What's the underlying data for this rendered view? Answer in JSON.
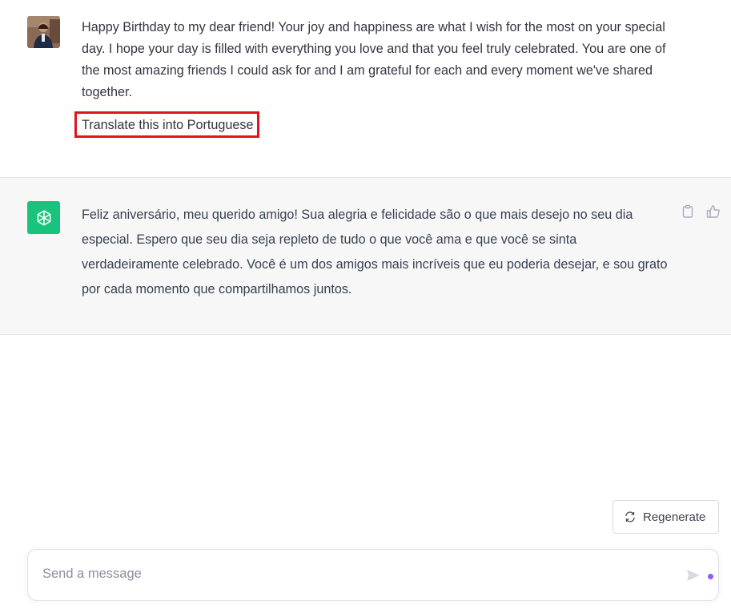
{
  "user_message": {
    "paragraph": "Happy Birthday to my dear friend! Your joy and happiness are what I wish for the most on your special day. I hope your day is filled with everything you love and that you feel truly celebrated. You are one of the most amazing friends I could ask for and I am grateful for each and every moment we've shared together.",
    "instruction": "Translate this into Portuguese"
  },
  "assistant_message": {
    "text": "Feliz aniversário, meu querido amigo! Sua alegria e felicidade são o que mais desejo no seu dia especial. Espero que seu dia seja repleto de tudo o que você ama e que você se sinta verdadeiramente celebrado. Você é um dos amigos mais incríveis que eu poderia desejar, e sou grato por cada momento que compartilhamos juntos."
  },
  "actions": {
    "copy_icon": "clipboard-icon",
    "like_icon": "thumbs-up-icon"
  },
  "regenerate": {
    "label": "Regenerate",
    "icon": "refresh-icon"
  },
  "composer": {
    "placeholder": "Send a message",
    "send_icon": "send-icon"
  },
  "colors": {
    "bot_accent": "#19c37d",
    "highlight_border": "#e0141e",
    "status_dot": "#8b5cf6"
  }
}
